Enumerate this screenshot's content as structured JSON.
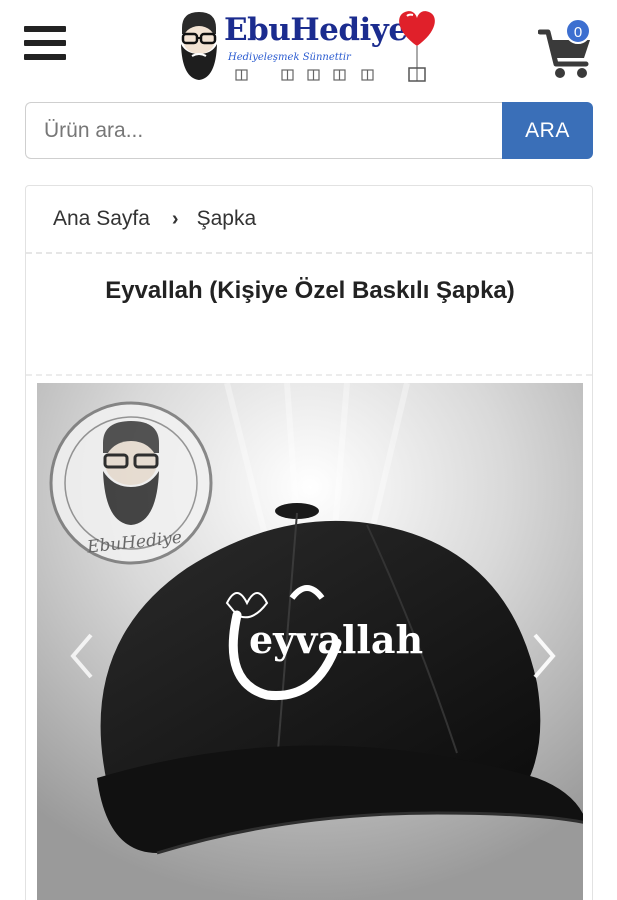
{
  "header": {
    "logo_text": "EbuHediye",
    "logo_tagline": "Hediyeleşmek Sünnettir",
    "cart_count": "0"
  },
  "search": {
    "placeholder": "Ürün ara...",
    "button_label": "ARA"
  },
  "breadcrumb": {
    "home": "Ana Sayfa",
    "current": "Şapka"
  },
  "product": {
    "title": "Eyvallah (Kişiye Özel Baskılı Şapka)",
    "cap_text": "eyvallah",
    "stamp_text": "EbuHediye"
  },
  "colors": {
    "accent": "#3a6fb8",
    "logo_blue": "#1b2c8f",
    "badge": "#3d6fd0"
  }
}
